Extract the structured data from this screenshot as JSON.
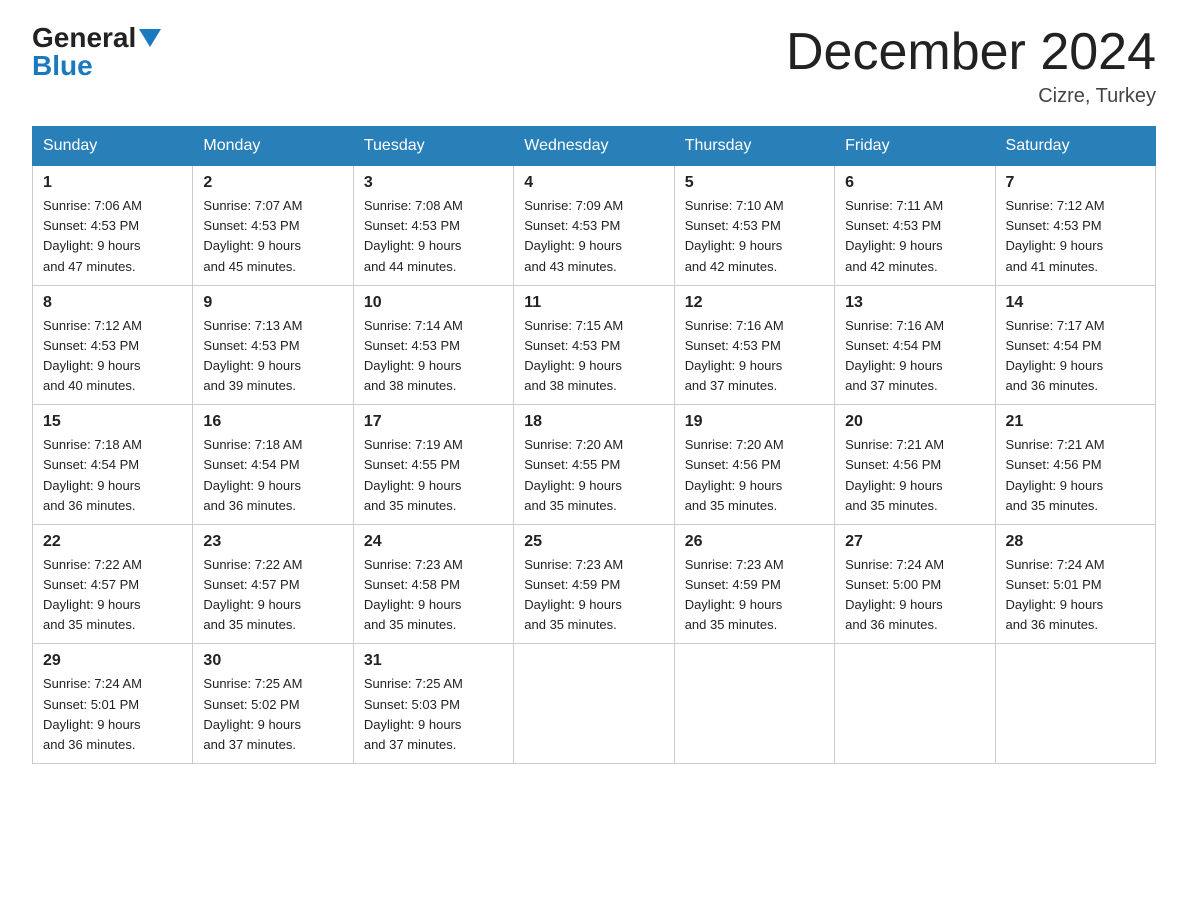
{
  "header": {
    "logo_general": "General",
    "logo_blue": "Blue",
    "month_title": "December 2024",
    "location": "Cizre, Turkey"
  },
  "days_of_week": [
    "Sunday",
    "Monday",
    "Tuesday",
    "Wednesday",
    "Thursday",
    "Friday",
    "Saturday"
  ],
  "weeks": [
    [
      {
        "day": "1",
        "sunrise": "7:06 AM",
        "sunset": "4:53 PM",
        "daylight": "9 hours and 47 minutes."
      },
      {
        "day": "2",
        "sunrise": "7:07 AM",
        "sunset": "4:53 PM",
        "daylight": "9 hours and 45 minutes."
      },
      {
        "day": "3",
        "sunrise": "7:08 AM",
        "sunset": "4:53 PM",
        "daylight": "9 hours and 44 minutes."
      },
      {
        "day": "4",
        "sunrise": "7:09 AM",
        "sunset": "4:53 PM",
        "daylight": "9 hours and 43 minutes."
      },
      {
        "day": "5",
        "sunrise": "7:10 AM",
        "sunset": "4:53 PM",
        "daylight": "9 hours and 42 minutes."
      },
      {
        "day": "6",
        "sunrise": "7:11 AM",
        "sunset": "4:53 PM",
        "daylight": "9 hours and 42 minutes."
      },
      {
        "day": "7",
        "sunrise": "7:12 AM",
        "sunset": "4:53 PM",
        "daylight": "9 hours and 41 minutes."
      }
    ],
    [
      {
        "day": "8",
        "sunrise": "7:12 AM",
        "sunset": "4:53 PM",
        "daylight": "9 hours and 40 minutes."
      },
      {
        "day": "9",
        "sunrise": "7:13 AM",
        "sunset": "4:53 PM",
        "daylight": "9 hours and 39 minutes."
      },
      {
        "day": "10",
        "sunrise": "7:14 AM",
        "sunset": "4:53 PM",
        "daylight": "9 hours and 38 minutes."
      },
      {
        "day": "11",
        "sunrise": "7:15 AM",
        "sunset": "4:53 PM",
        "daylight": "9 hours and 38 minutes."
      },
      {
        "day": "12",
        "sunrise": "7:16 AM",
        "sunset": "4:53 PM",
        "daylight": "9 hours and 37 minutes."
      },
      {
        "day": "13",
        "sunrise": "7:16 AM",
        "sunset": "4:54 PM",
        "daylight": "9 hours and 37 minutes."
      },
      {
        "day": "14",
        "sunrise": "7:17 AM",
        "sunset": "4:54 PM",
        "daylight": "9 hours and 36 minutes."
      }
    ],
    [
      {
        "day": "15",
        "sunrise": "7:18 AM",
        "sunset": "4:54 PM",
        "daylight": "9 hours and 36 minutes."
      },
      {
        "day": "16",
        "sunrise": "7:18 AM",
        "sunset": "4:54 PM",
        "daylight": "9 hours and 36 minutes."
      },
      {
        "day": "17",
        "sunrise": "7:19 AM",
        "sunset": "4:55 PM",
        "daylight": "9 hours and 35 minutes."
      },
      {
        "day": "18",
        "sunrise": "7:20 AM",
        "sunset": "4:55 PM",
        "daylight": "9 hours and 35 minutes."
      },
      {
        "day": "19",
        "sunrise": "7:20 AM",
        "sunset": "4:56 PM",
        "daylight": "9 hours and 35 minutes."
      },
      {
        "day": "20",
        "sunrise": "7:21 AM",
        "sunset": "4:56 PM",
        "daylight": "9 hours and 35 minutes."
      },
      {
        "day": "21",
        "sunrise": "7:21 AM",
        "sunset": "4:56 PM",
        "daylight": "9 hours and 35 minutes."
      }
    ],
    [
      {
        "day": "22",
        "sunrise": "7:22 AM",
        "sunset": "4:57 PM",
        "daylight": "9 hours and 35 minutes."
      },
      {
        "day": "23",
        "sunrise": "7:22 AM",
        "sunset": "4:57 PM",
        "daylight": "9 hours and 35 minutes."
      },
      {
        "day": "24",
        "sunrise": "7:23 AM",
        "sunset": "4:58 PM",
        "daylight": "9 hours and 35 minutes."
      },
      {
        "day": "25",
        "sunrise": "7:23 AM",
        "sunset": "4:59 PM",
        "daylight": "9 hours and 35 minutes."
      },
      {
        "day": "26",
        "sunrise": "7:23 AM",
        "sunset": "4:59 PM",
        "daylight": "9 hours and 35 minutes."
      },
      {
        "day": "27",
        "sunrise": "7:24 AM",
        "sunset": "5:00 PM",
        "daylight": "9 hours and 36 minutes."
      },
      {
        "day": "28",
        "sunrise": "7:24 AM",
        "sunset": "5:01 PM",
        "daylight": "9 hours and 36 minutes."
      }
    ],
    [
      {
        "day": "29",
        "sunrise": "7:24 AM",
        "sunset": "5:01 PM",
        "daylight": "9 hours and 36 minutes."
      },
      {
        "day": "30",
        "sunrise": "7:25 AM",
        "sunset": "5:02 PM",
        "daylight": "9 hours and 37 minutes."
      },
      {
        "day": "31",
        "sunrise": "7:25 AM",
        "sunset": "5:03 PM",
        "daylight": "9 hours and 37 minutes."
      },
      null,
      null,
      null,
      null
    ]
  ],
  "labels": {
    "sunrise": "Sunrise:",
    "sunset": "Sunset:",
    "daylight": "Daylight:"
  }
}
